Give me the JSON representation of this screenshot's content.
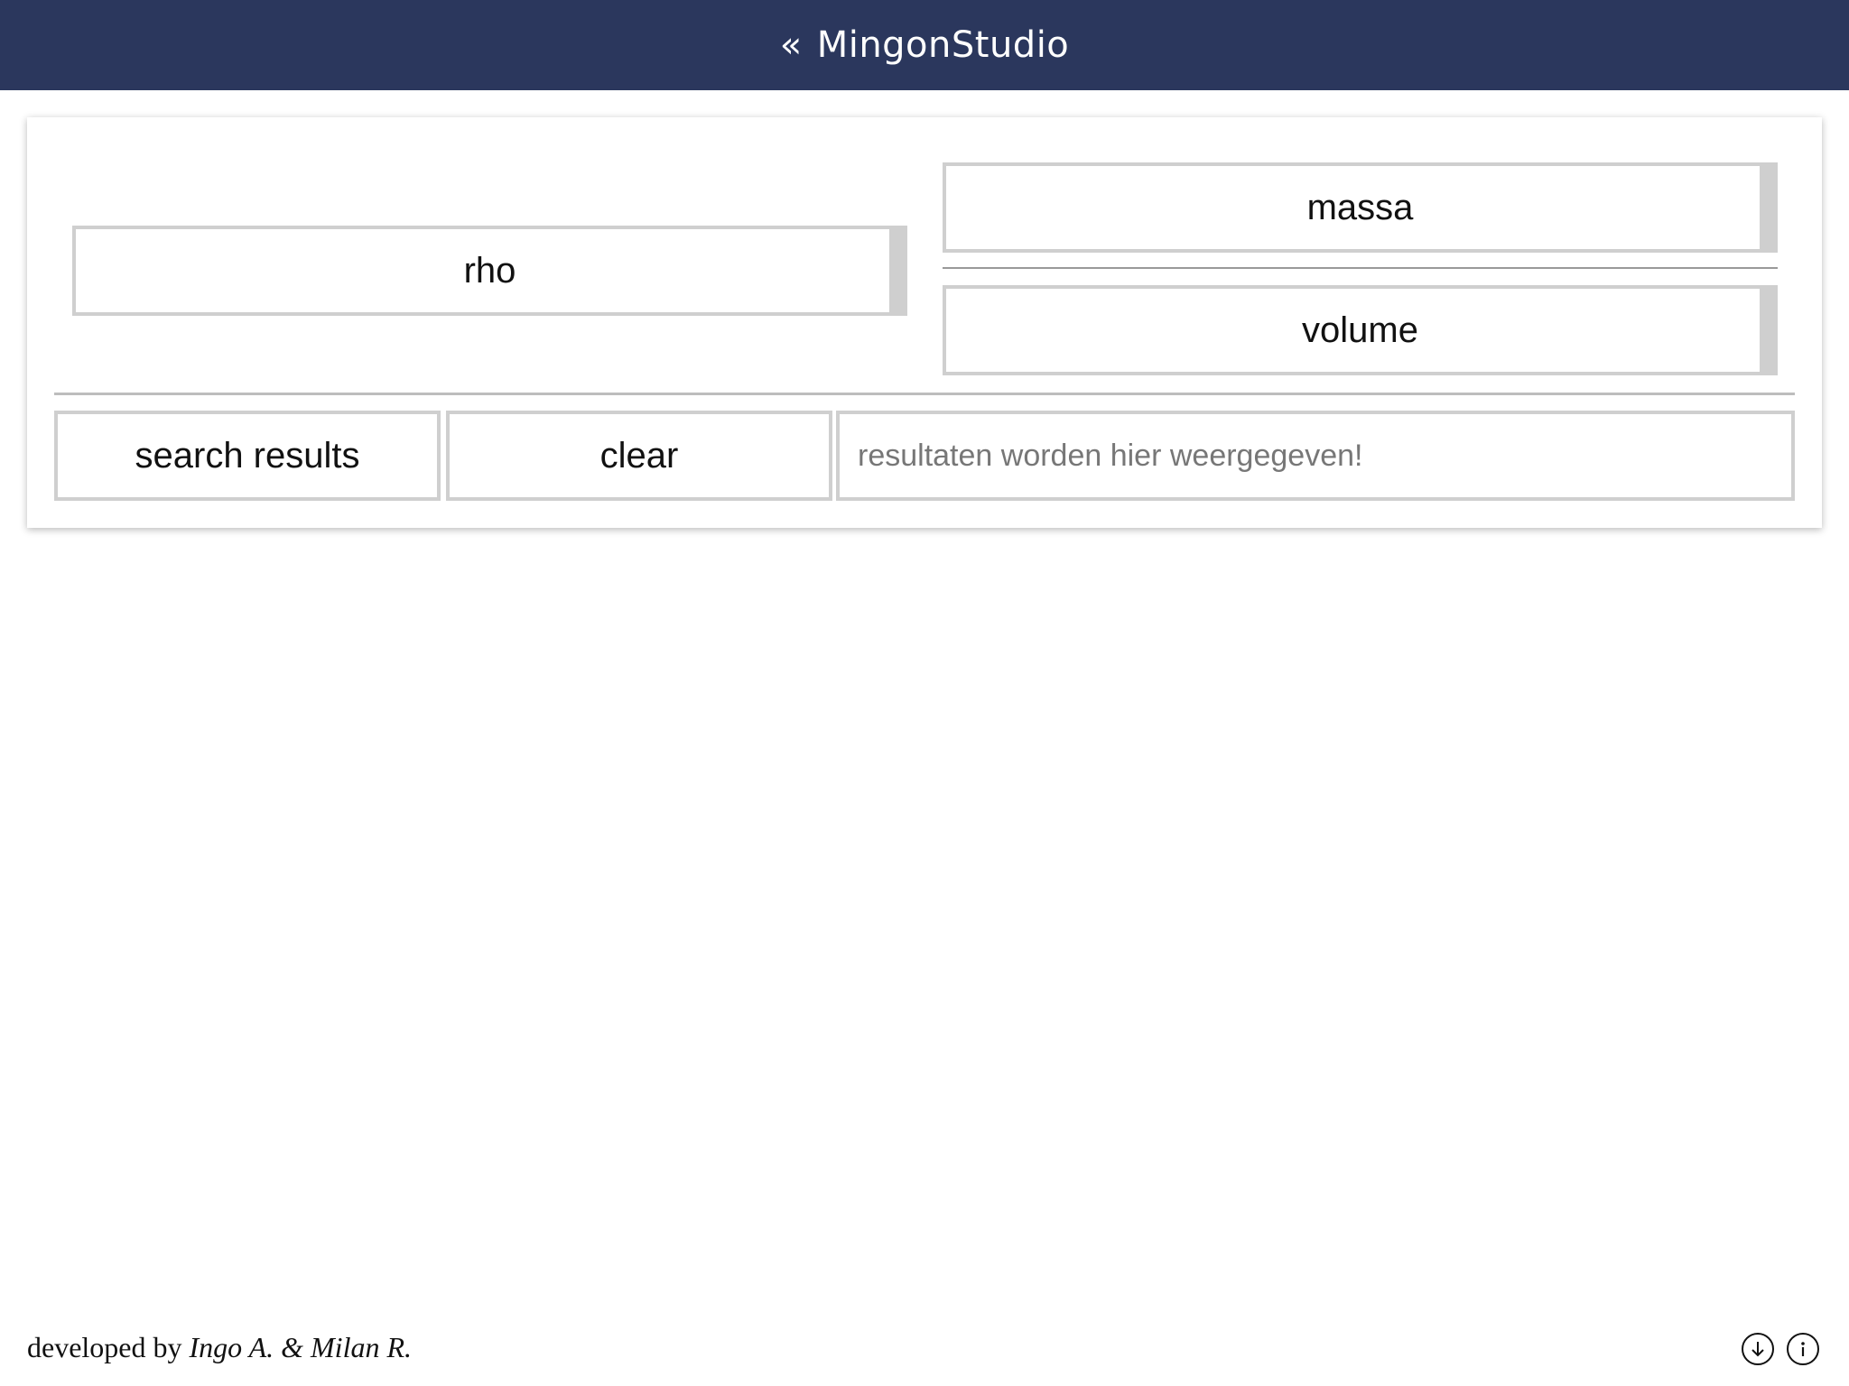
{
  "header": {
    "back_glyph": "«",
    "title": "MingonStudio"
  },
  "calculator": {
    "rho": {
      "placeholder": "rho",
      "value": ""
    },
    "massa": {
      "placeholder": "massa",
      "value": ""
    },
    "volume": {
      "placeholder": "volume",
      "value": ""
    }
  },
  "actions": {
    "search_label": "search results",
    "clear_label": "clear"
  },
  "results": {
    "text": "resultaten worden hier weergegeven!"
  },
  "footer": {
    "credit_prefix": "developed by",
    "credit_names": "Ingo A. & Milan R.",
    "icons": [
      "download-icon",
      "info-icon"
    ]
  },
  "colors": {
    "header_bg": "#2b375d",
    "header_text": "#ffffff",
    "field_border": "#cfcfcf",
    "muted_text": "#777777"
  }
}
